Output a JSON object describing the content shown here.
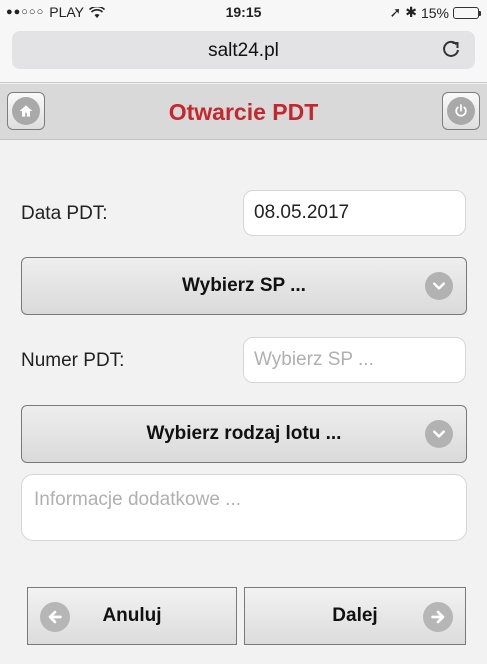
{
  "status": {
    "carrier": "PLAY",
    "time": "19:15",
    "battery": "15%",
    "battery_level": 0.15,
    "battery_color": "#e0182d"
  },
  "browser": {
    "url": "salt24.pl"
  },
  "header": {
    "title": "Otwarcie PDT",
    "accent_color": "#c4282e"
  },
  "form": {
    "date_label": "Data PDT:",
    "date_value": "08.05.2017",
    "sp_select": "Wybierz SP ...",
    "number_label": "Numer PDT:",
    "number_placeholder": "Wybierz SP ...",
    "flight_type_select": "Wybierz rodzaj lotu ...",
    "info_placeholder": "Informacje dodatkowe ..."
  },
  "actions": {
    "cancel": "Anuluj",
    "next": "Dalej"
  }
}
